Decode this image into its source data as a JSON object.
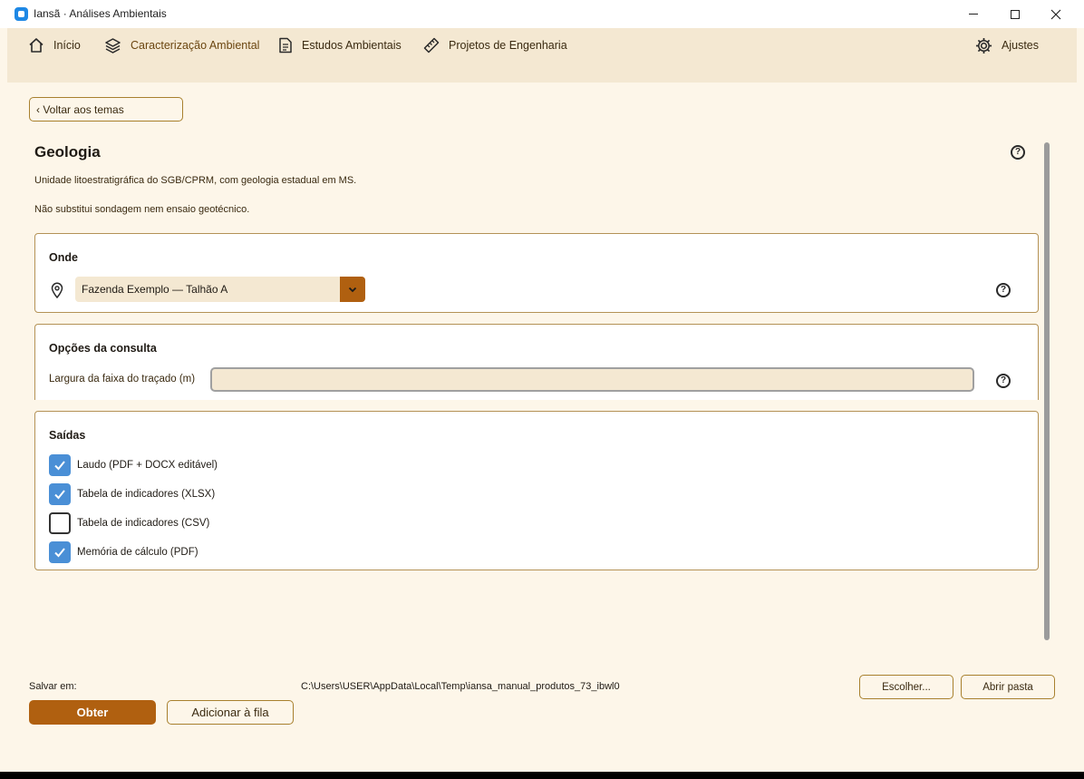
{
  "window": {
    "title": "Iansã · Análises Ambientais"
  },
  "nav": {
    "items": [
      {
        "label": "Início",
        "icon": "home-icon"
      },
      {
        "label": "Caracterização Ambiental",
        "icon": "layers-icon"
      },
      {
        "label": "Estudos Ambientais",
        "icon": "document-icon"
      },
      {
        "label": "Projetos de Engenharia",
        "icon": "ruler-icon"
      }
    ],
    "settings": {
      "label": "Ajustes",
      "icon": "gear-icon"
    }
  },
  "back_label": "‹ Voltar aos temas",
  "page": {
    "title": "Geologia",
    "description": "Unidade litoestratigráfica do SGB/CPRM, com geologia estadual em MS.",
    "note": "Não substitui sondagem nem ensaio geotécnico."
  },
  "location": {
    "title": "Onde",
    "selected": "Fazenda Exemplo — Talhão A"
  },
  "options": {
    "title": "Opções da consulta",
    "field_label": "Largura da faixa do traçado (m)",
    "field_value": ""
  },
  "outputs": {
    "title": "Saídas",
    "items": [
      {
        "label": "Laudo (PDF + DOCX editável)",
        "checked": true
      },
      {
        "label": "Tabela de indicadores (XLSX)",
        "checked": true
      },
      {
        "label": "Tabela de indicadores (CSV)",
        "checked": false
      },
      {
        "label": "Memória de cálculo (PDF)",
        "checked": true
      }
    ]
  },
  "footer": {
    "save_label": "Salvar em:",
    "save_path": "C:\\Users\\USER\\AppData\\Local\\Temp\\iansa_manual_produtos_73_ibwl0",
    "choose_label": "Escolher...",
    "open_folder_label": "Abrir pasta",
    "get_label": "Obter",
    "queue_label": "Adicionar à fila"
  },
  "colors": {
    "accent": "#b06010",
    "nav_background": "#f4e8d2",
    "page_background": "#fdf6e9",
    "checkbox_checked": "#4a8fd6",
    "card_border": "#b49256"
  }
}
